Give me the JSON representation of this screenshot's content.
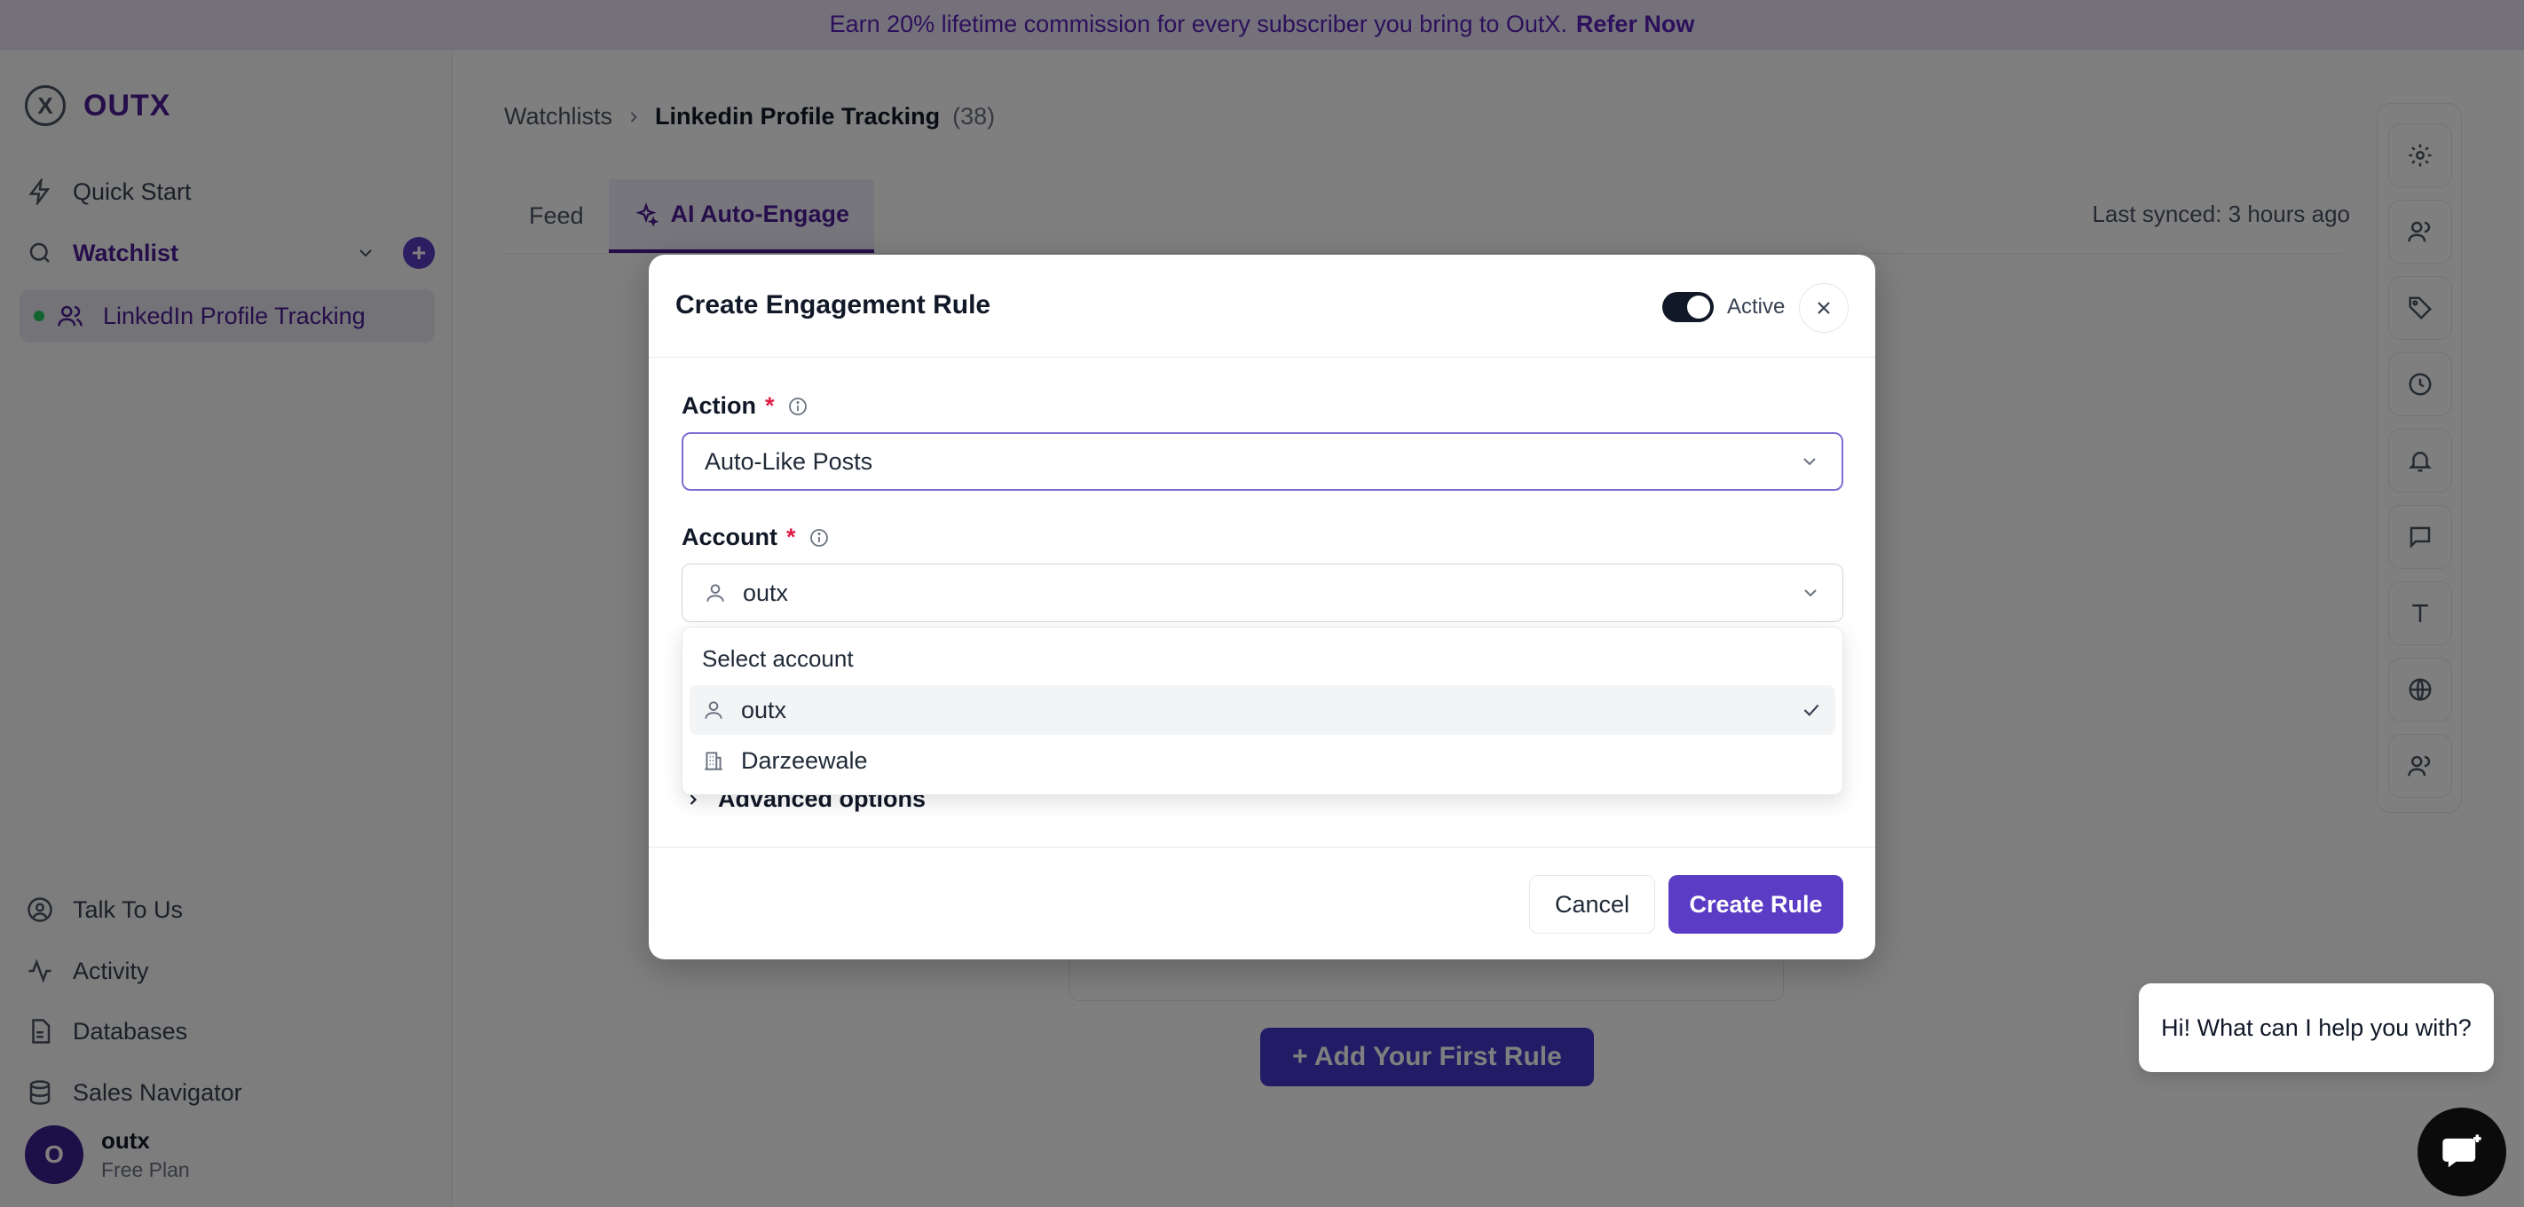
{
  "banner": {
    "text": "Earn 20% lifetime commission for every subscriber you bring to OutX.",
    "link": "Refer Now"
  },
  "brand": {
    "name": "OUTX",
    "logo_letter": "X"
  },
  "sidebar": {
    "items": [
      {
        "label": "Quick Start",
        "icon": "bolt-icon"
      },
      {
        "label": "Watchlist",
        "icon": "search-icon"
      },
      {
        "label": "LinkedIn Profile Tracking",
        "icon": "users-icon"
      }
    ],
    "bottom_items": [
      {
        "label": "Talk To Us",
        "icon": "user-circle-icon"
      },
      {
        "label": "Activity",
        "icon": "activity-icon"
      },
      {
        "label": "Databases",
        "icon": "file-icon"
      },
      {
        "label": "Sales Navigator",
        "icon": "database-icon"
      }
    ],
    "user": {
      "initial": "O",
      "name": "outx",
      "plan": "Free Plan"
    }
  },
  "breadcrumb": {
    "root": "Watchlists",
    "current": "Linkedin Profile Tracking",
    "count": "(38)"
  },
  "tabs": [
    {
      "label": "Feed"
    },
    {
      "label": "AI Auto-Engage"
    }
  ],
  "synced": "Last synced: 3 hours ago",
  "add_rule_button": "+ Add Your First Rule",
  "modal": {
    "title": "Create Engagement Rule",
    "status_label": "Active",
    "action": {
      "label": "Action",
      "required_mark": "*",
      "value": "Auto-Like Posts"
    },
    "account": {
      "label": "Account",
      "required_mark": "*",
      "value": "outx",
      "dropdown_header": "Select account",
      "options": [
        {
          "label": "outx",
          "selected": true
        },
        {
          "label": "Darzeewale",
          "selected": false
        }
      ]
    },
    "advanced_label": "Advanced options",
    "cancel_label": "Cancel",
    "create_label": "Create Rule"
  },
  "chat": {
    "greeting": "Hi! What can I help you with?"
  },
  "colors": {
    "accent": "#5b3cc4",
    "brand": "#4c1d95",
    "primary_button": "#4338ca",
    "banner_bg": "#e9e3f7"
  }
}
